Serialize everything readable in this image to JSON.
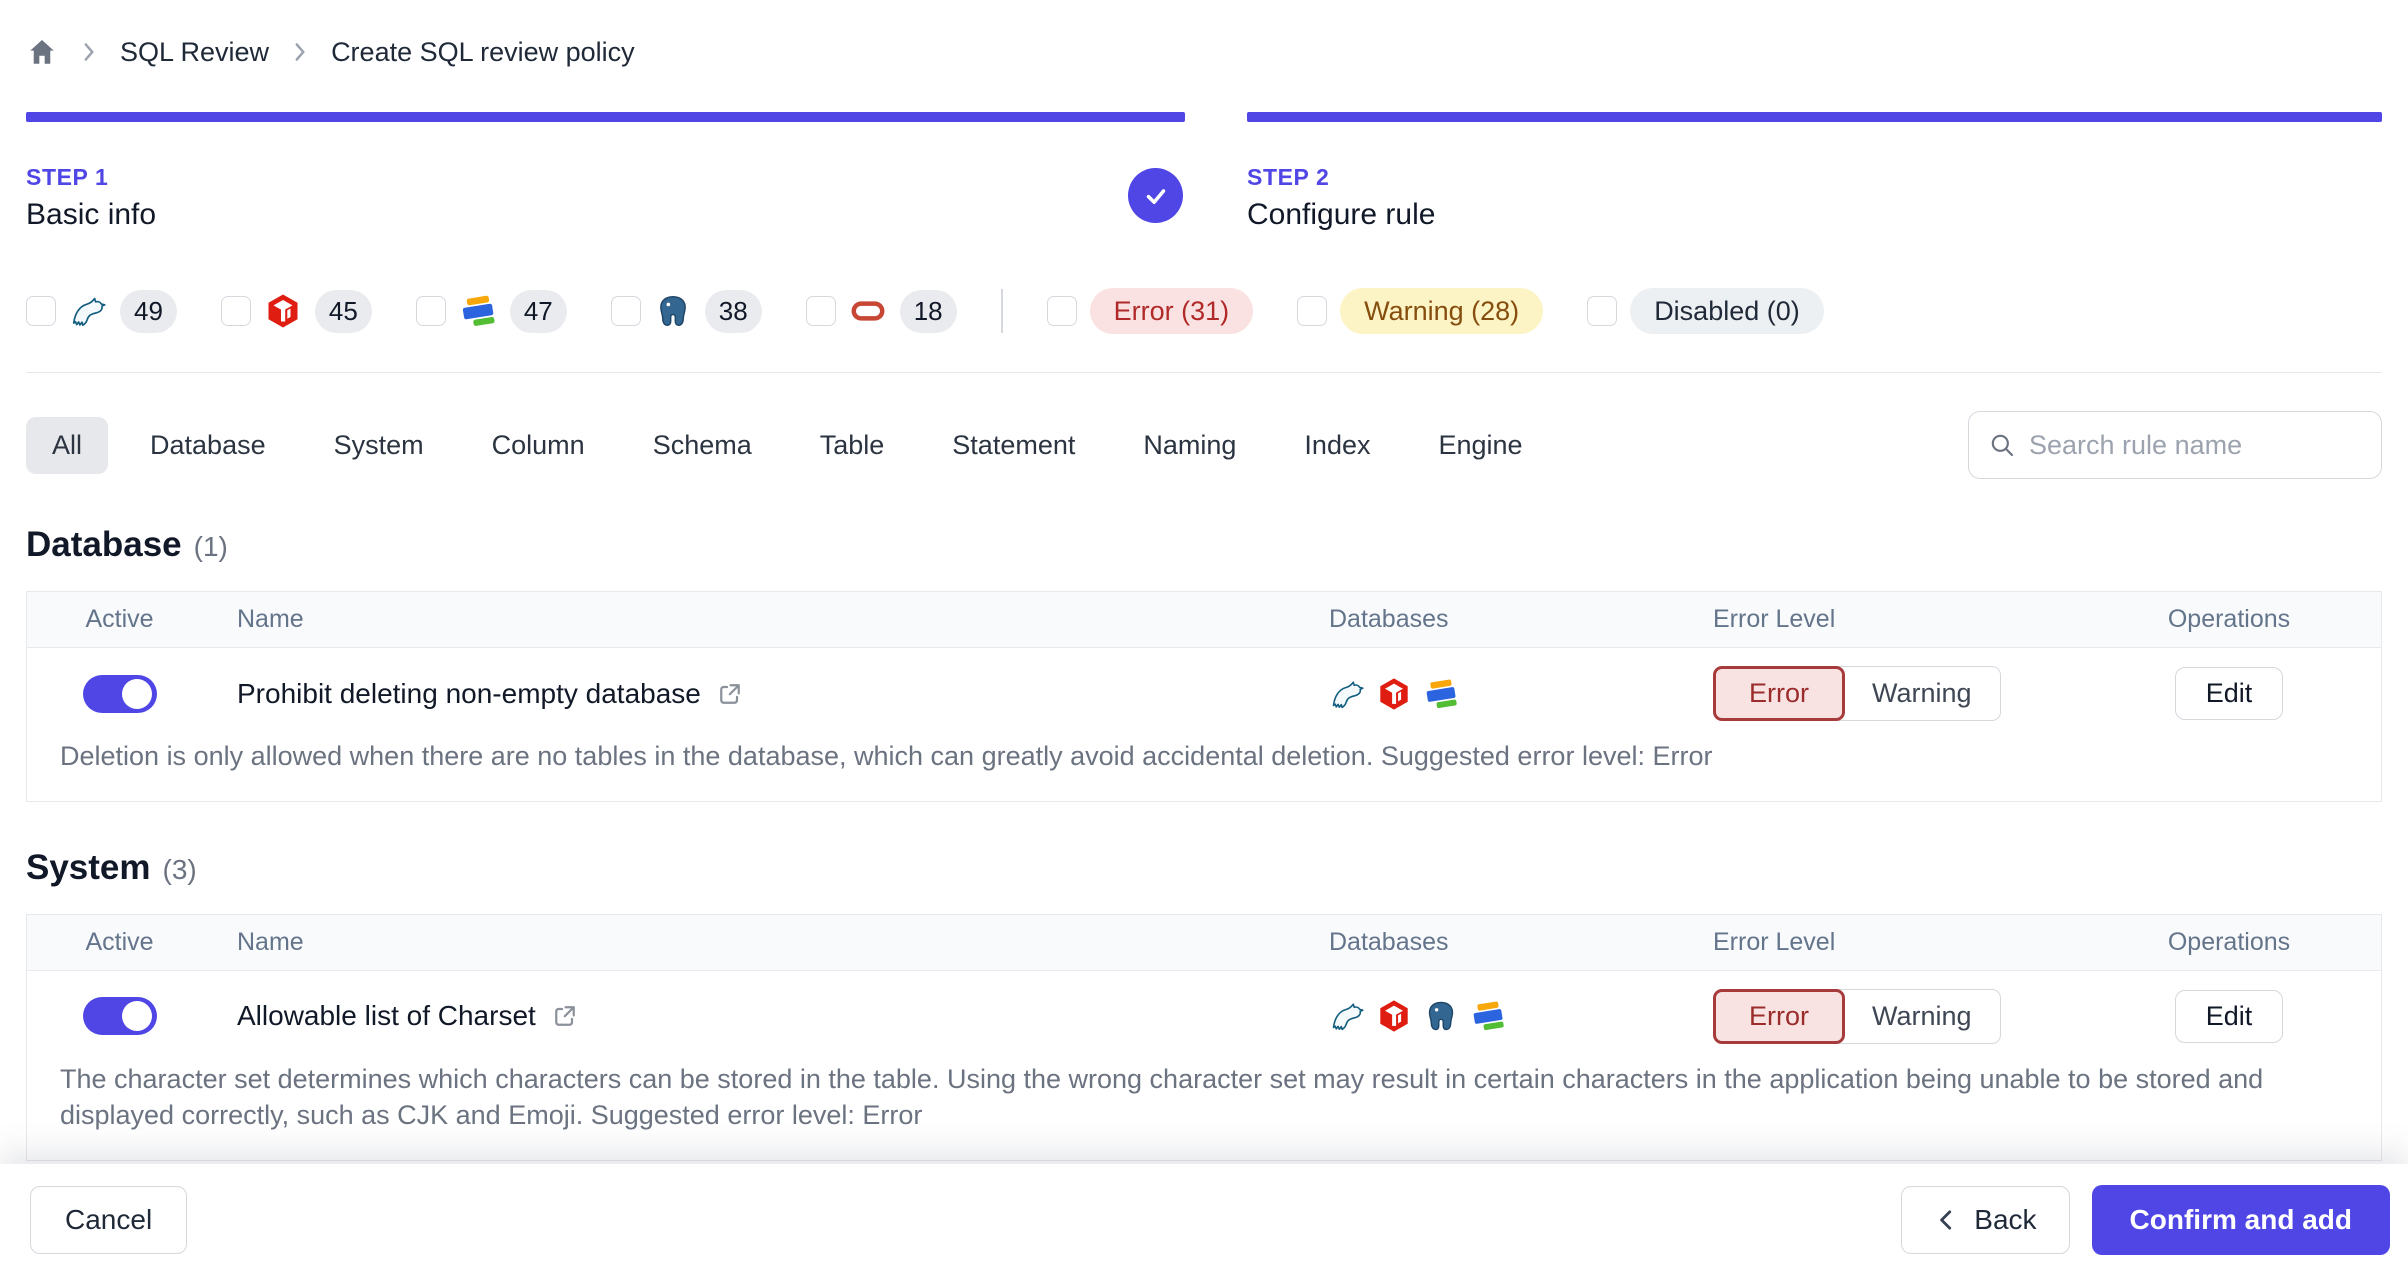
{
  "breadcrumb": {
    "home_icon": "home-icon",
    "separator_icon": "chevron-right-icon",
    "items": [
      "SQL Review",
      "Create SQL review policy"
    ]
  },
  "steps": [
    {
      "label": "STEP 1",
      "title": "Basic info",
      "completed": true,
      "status_icon": "check-icon"
    },
    {
      "label": "STEP 2",
      "title": "Configure rule",
      "completed": false
    }
  ],
  "filters": {
    "engines": [
      {
        "engine": "MySQL",
        "icon": "mysql-icon",
        "count": "49",
        "checked": false
      },
      {
        "engine": "TiDB",
        "icon": "tidb-icon",
        "count": "45",
        "checked": false
      },
      {
        "engine": "OceanBase",
        "icon": "oceanbase-icon",
        "count": "47",
        "checked": false
      },
      {
        "engine": "PostgreSQL",
        "icon": "postgresql-icon",
        "count": "38",
        "checked": false
      },
      {
        "engine": "Oracle",
        "icon": "oracle-icon",
        "count": "18",
        "checked": false
      }
    ],
    "levels": [
      {
        "label": "Error (31)",
        "text_color": "#B02A2A",
        "bg_color": "#FBE2E2",
        "checked": false
      },
      {
        "label": "Warning (28)",
        "text_color": "#854D0E",
        "bg_color": "#FDF4C5",
        "checked": false
      },
      {
        "label": "Disabled (0)",
        "text_color": "#1F2937",
        "bg_color": "#EDF0F3",
        "checked": false
      }
    ]
  },
  "tabs": {
    "active": "All",
    "items": [
      "All",
      "Database",
      "System",
      "Column",
      "Schema",
      "Table",
      "Statement",
      "Naming",
      "Index",
      "Engine"
    ]
  },
  "search": {
    "placeholder": "Search rule name",
    "icon": "search-icon",
    "value": ""
  },
  "table_columns": [
    "Active",
    "Name",
    "Databases",
    "Error Level",
    "Operations"
  ],
  "sections": [
    {
      "title": "Database",
      "count": "(1)",
      "rows": [
        {
          "active": true,
          "name": "Prohibit deleting non-empty database",
          "link_icon": "external-link-icon",
          "databases": [
            "MySQL",
            "TiDB",
            "OceanBase"
          ],
          "error_level": "Error",
          "level_options": [
            "Error",
            "Warning"
          ],
          "operation": "Edit",
          "description": "Deletion is only allowed when there are no tables in the database, which can greatly avoid accidental deletion. Suggested error level: Error"
        }
      ]
    },
    {
      "title": "System",
      "count": "(3)",
      "rows": [
        {
          "active": true,
          "name": "Allowable list of Charset",
          "link_icon": "external-link-icon",
          "databases": [
            "MySQL",
            "TiDB",
            "PostgreSQL",
            "OceanBase"
          ],
          "error_level": "Error",
          "level_options": [
            "Error",
            "Warning"
          ],
          "operation": "Edit",
          "description": "The character set determines which characters can be stored in the table. Using the wrong character set may result in certain characters in the application being unable to be stored and displayed correctly, such as CJK and Emoji. Suggested error level: Error"
        }
      ]
    }
  ],
  "footer": {
    "cancel_label": "Cancel",
    "back_label": "Back",
    "back_icon": "chevron-left-icon",
    "confirm_label": "Confirm and add"
  },
  "colors": {
    "accent": "#4F46E5",
    "error_text": "#9B2C2C",
    "error_bg": "#F9E2E2",
    "header_bg": "#F8FAFC"
  }
}
